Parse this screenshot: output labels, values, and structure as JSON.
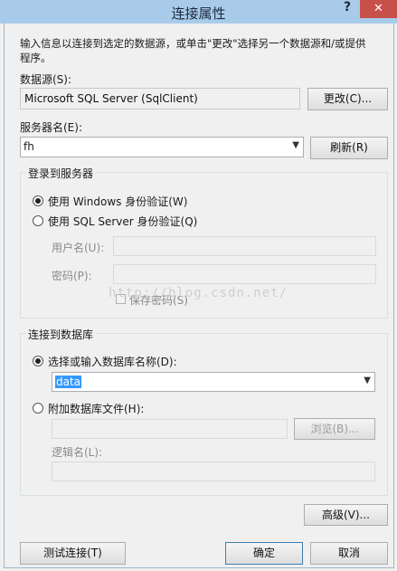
{
  "window": {
    "title": "连接属性",
    "help_glyph": "?",
    "close_glyph": "✕"
  },
  "instruction": {
    "line1": "输入信息以连接到选定的数据源，或单击\"更改\"选择另一个数据源和/或提供",
    "line2": "程序。"
  },
  "datasource": {
    "label": "数据源(S):",
    "value": "Microsoft SQL Server (SqlClient)",
    "change_button": "更改(C)..."
  },
  "server": {
    "label": "服务器名(E):",
    "value": "fh",
    "refresh_button": "刷新(R)"
  },
  "login_group": {
    "title": "登录到服务器",
    "windows_auth": "使用 Windows 身份验证(W)",
    "sql_auth": "使用 SQL Server 身份验证(Q)",
    "username_label": "用户名(U):",
    "password_label": "密码(P):",
    "save_password": "保存密码(S)",
    "selected": "windows"
  },
  "watermark": "http://blog.csdn.net/",
  "db_group": {
    "title": "连接到数据库",
    "select_db_label": "选择或输入数据库名称(D):",
    "db_value": "data",
    "attach_label": "附加数据库文件(H):",
    "browse_button": "浏览(B)...",
    "logical_name_label": "逻辑名(L):",
    "selected": "select"
  },
  "buttons": {
    "advanced": "高级(V)...",
    "test": "测试连接(T)",
    "ok": "确定",
    "cancel": "取消"
  },
  "colors": {
    "titlebar": "#a9cbea",
    "close": "#c7504a",
    "selection": "#3399ff"
  }
}
